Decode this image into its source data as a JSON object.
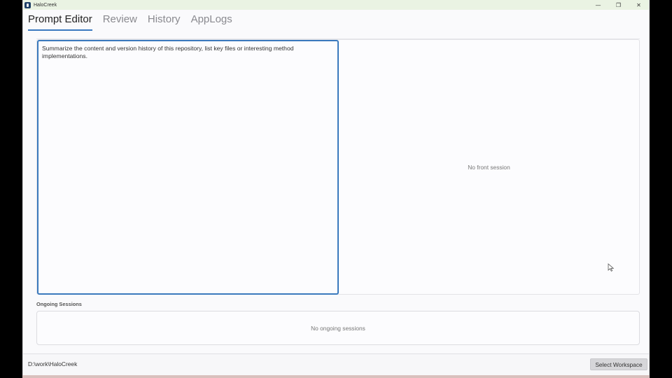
{
  "window": {
    "title": "HaloCreek",
    "controls": {
      "minimize": "—",
      "restore": "❐",
      "close": "✕"
    }
  },
  "tabs": [
    {
      "label": "Prompt Editor",
      "active": true
    },
    {
      "label": "Review",
      "active": false
    },
    {
      "label": "History",
      "active": false
    },
    {
      "label": "AppLogs",
      "active": false
    }
  ],
  "editor": {
    "prompt_text": "Summarize the content and version history of this repository, list key files or interesting method implementations.",
    "front_session_status": "No front session"
  },
  "sessions": {
    "label": "Ongoing Sessions",
    "empty_text": "No ongoing sessions"
  },
  "footer": {
    "workspace_path": "D:\\work\\HaloCreek",
    "select_workspace_label": "Select Workspace"
  },
  "colors": {
    "accent": "#3b79bf",
    "titlebar": "#eaf3e3",
    "app_icon": "#1e3f66"
  },
  "icons": {
    "app": "app-logo-icon",
    "minimize": "minimize-icon",
    "restore": "restore-icon",
    "close": "close-icon",
    "cursor": "mouse-cursor-icon"
  }
}
